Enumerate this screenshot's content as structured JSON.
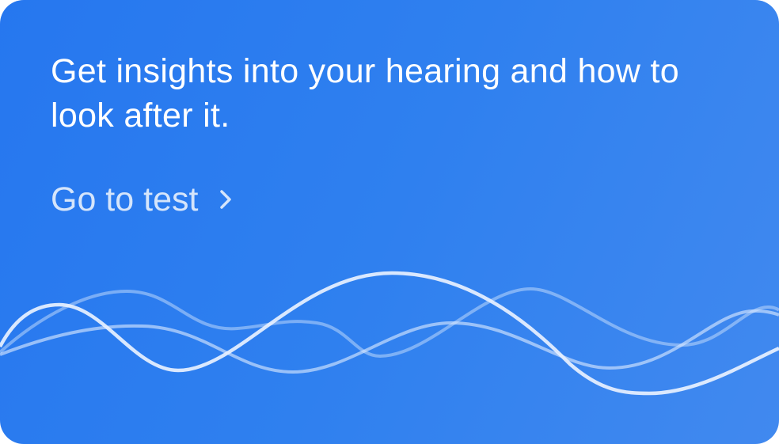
{
  "card": {
    "headline": "Get insights into your hearing and how to look after it.",
    "link_label": "Go to test",
    "link_icon": "chevron-right-icon"
  },
  "colors": {
    "background_start": "#2677ef",
    "background_end": "#4189ef",
    "link": "#d5e5fb"
  }
}
